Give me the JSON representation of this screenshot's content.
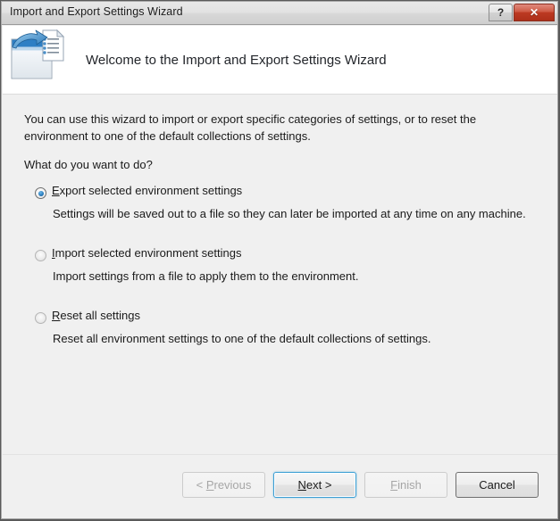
{
  "window": {
    "title": "Import and Export Settings Wizard",
    "help_button": "?",
    "close_button": "✕"
  },
  "header": {
    "icon": "export-settings-icon",
    "title": "Welcome to the Import and Export Settings Wizard"
  },
  "body": {
    "intro": "You can use this wizard to import or export specific categories of settings, or to reset the environment to one of the default collections of settings.",
    "question": "What do you want to do?",
    "options": [
      {
        "accel": "E",
        "label_rest": "xport selected environment settings",
        "description": "Settings will be saved out to a file so they can later be imported at any time on any machine.",
        "selected": true
      },
      {
        "accel": "I",
        "label_rest": "mport selected environment settings",
        "description": "Import settings from a file to apply them to the environment.",
        "selected": false
      },
      {
        "accel": "R",
        "label_rest": "eset all settings",
        "description": "Reset all environment settings to one of the default collections of settings.",
        "selected": false
      }
    ]
  },
  "footer": {
    "previous": {
      "text_before": "< ",
      "accel": "P",
      "text_after": "revious",
      "enabled": false
    },
    "next": {
      "text_before": "",
      "accel": "N",
      "text_after": "ext >",
      "enabled": true,
      "is_default": true
    },
    "finish": {
      "text_before": "",
      "accel": "F",
      "text_after": "inish",
      "enabled": false
    },
    "cancel": {
      "label": "Cancel",
      "enabled": true
    }
  },
  "colors": {
    "accent": "#3c9fd4",
    "close_red": "#bd3a22",
    "body_bg": "#f0f0f0",
    "header_bg": "#ffffff"
  }
}
